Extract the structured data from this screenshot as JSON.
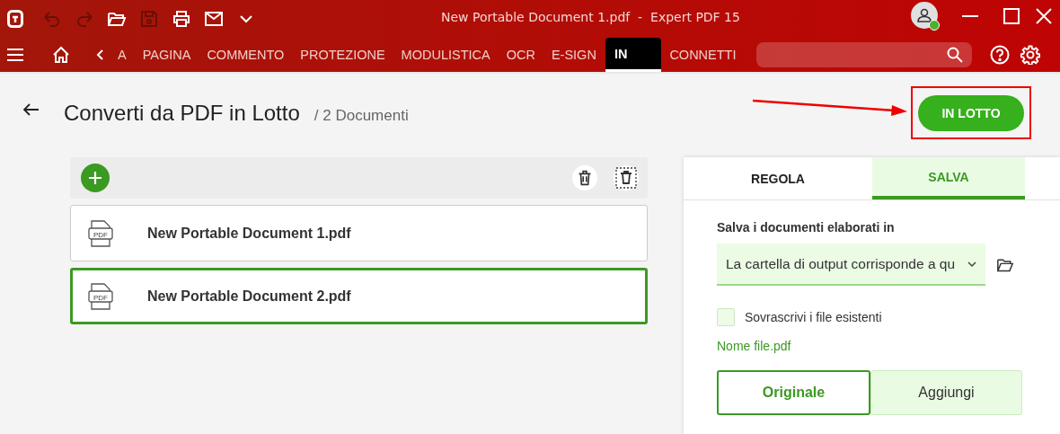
{
  "window": {
    "title": "New Portable Document 1.pdf  -  Expert PDF 15"
  },
  "quick_access": [
    {
      "kind": "undo",
      "disabled": true
    },
    {
      "kind": "redo",
      "disabled": true
    },
    {
      "kind": "open",
      "disabled": false
    },
    {
      "kind": "save",
      "disabled": true
    },
    {
      "kind": "print",
      "disabled": false
    },
    {
      "kind": "mail",
      "disabled": false
    },
    {
      "kind": "more",
      "disabled": false
    }
  ],
  "user": {
    "online": true
  },
  "ribbon_tabs": [
    {
      "label": "A",
      "selected": false
    },
    {
      "label": "PAGINA",
      "selected": false
    },
    {
      "label": "COMMENTO",
      "selected": false
    },
    {
      "label": "PROTEZIONE",
      "selected": false
    },
    {
      "label": "MODULISTICA",
      "selected": false
    },
    {
      "label": "OCR",
      "selected": false
    },
    {
      "label": "E-SIGN",
      "selected": false
    },
    {
      "label": "IN",
      "selected": true
    },
    {
      "label": "CONNETTI",
      "selected": false
    }
  ],
  "page": {
    "title": "Converti da PDF in Lotto",
    "subtitle": "/ 2 Documenti",
    "action": "IN LOTTO"
  },
  "documents": [
    {
      "name": "New Portable Document 1.pdf",
      "file_type": "PDF",
      "selected": false
    },
    {
      "name": "New Portable Document 2.pdf",
      "file_type": "PDF",
      "selected": true
    }
  ],
  "panel": {
    "tabs": [
      {
        "label": "REGOLA",
        "selected": false
      },
      {
        "label": "SALVA",
        "selected": true
      }
    ],
    "folder_label": "Salva i documenti elaborati in",
    "folder_value": "La cartella di output corrisponde a qu",
    "overwrite": {
      "label": "Sovrascrivi i file esistenti",
      "checked": false
    },
    "filename": "Nome file.pdf",
    "modes": [
      {
        "label": "Originale",
        "selected": true
      },
      {
        "label": "Aggiungi",
        "selected": false
      }
    ]
  }
}
